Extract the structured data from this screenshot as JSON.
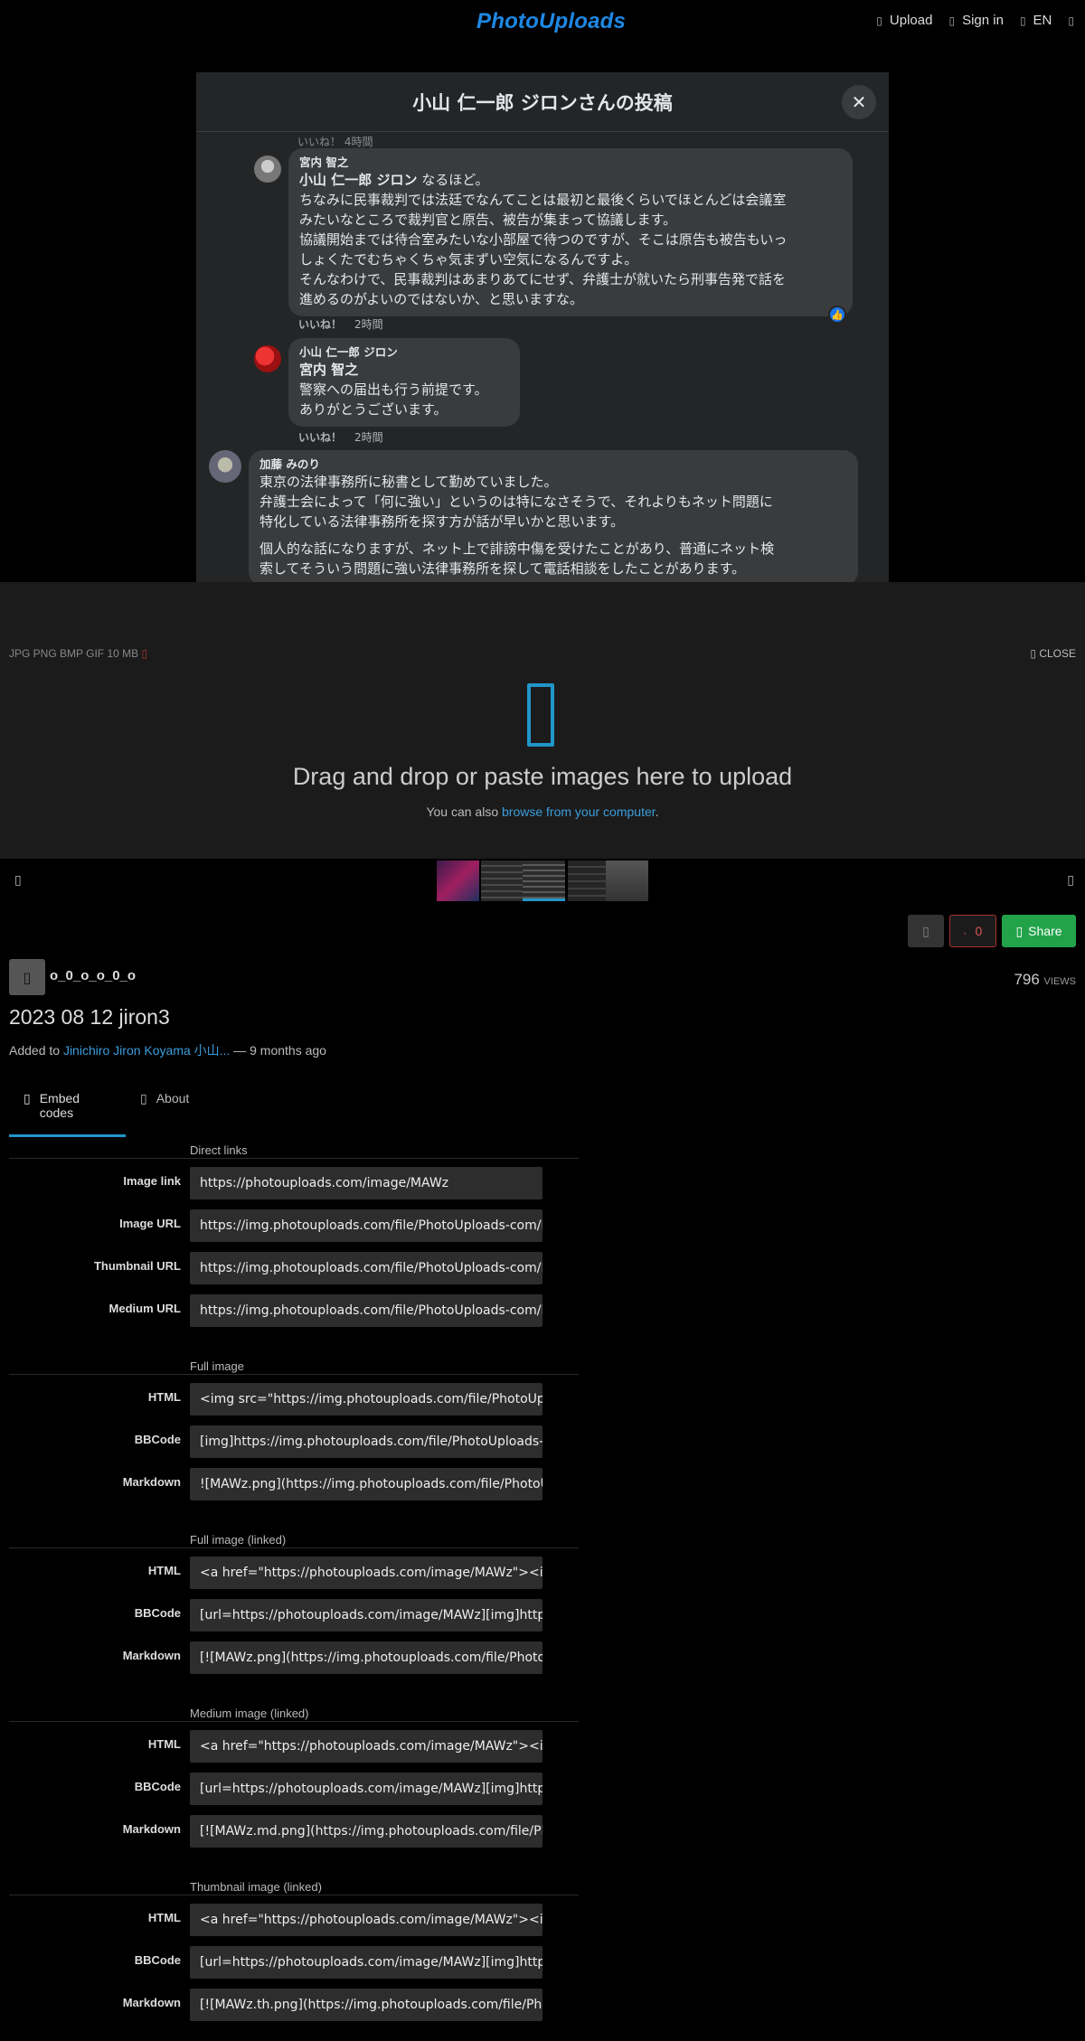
{
  "top": {
    "logo": "PhotoUploads",
    "upload": "Upload",
    "signin": "Sign in",
    "lang": "EN"
  },
  "shot": {
    "title": "小山 仁一郎 ジロンさんの投稿",
    "faded": "いいね！    4時間",
    "c1": {
      "author": "宮内 智之",
      "mention": "小山 仁一郎 ジロン",
      "line1_rest": " なるほど。",
      "lines": [
        "ちなみに民事裁判では法廷でなんてことは最初と最後くらいでほとんどは会議室",
        "みたいなところで裁判官と原告、被告が集まって協議します。",
        "協議開始までは待合室みたいな小部屋で待つのですが、そこは原告も被告もいっ",
        "しょくたでむちゃくちゃ気まずい空気になるんですよ。",
        "そんなわけで、民事裁判はあまりあてにせず、弁護士が就いたら刑事告発で話を",
        "進めるのがよいのではないか、と思いますな。"
      ],
      "like": "いいね！",
      "time": "2時間"
    },
    "c2": {
      "author": "小山 仁一郎 ジロン",
      "mention": "宮内 智之",
      "lines": [
        "警察への届出も行う前提です。",
        "ありがとうございます。"
      ],
      "like": "いいね！",
      "time": "2時間"
    },
    "c3": {
      "author": "加藤 みのり",
      "lines": [
        "東京の法律事務所に秘書として勤めていました。",
        "弁護士会によって「何に強い」というのは特になさそうで、それよりもネット問題に",
        "特化している法律事務所を探す方が話が早いかと思います。"
      ],
      "lines2": [
        "個人的な話になりますが、ネット上で誹謗中傷を受けたことがあり、普通にネット検",
        "索してそういう問題に強い法律事務所を探して電話相談をしたことがあります。"
      ]
    }
  },
  "uploader": {
    "formats": "JPG PNG BMP GIF   10 MB",
    "close": "CLOSE",
    "title": "Drag and drop or paste images here to upload",
    "sub_prefix": "You can also ",
    "sub_link": "browse from your computer",
    "sub_suffix": "."
  },
  "meta": {
    "likes": "0",
    "share": "Share",
    "owner": "o_0_o_o_0_o",
    "views_count": "796",
    "views_label": "VIEWS",
    "title": "2023 08 12 jiron3",
    "added_prefix": "Added to ",
    "album": "Jinichiro Jiron Koyama 小山...",
    "added_suffix": " — 9 months ago"
  },
  "tabs": {
    "embed": "Embed codes",
    "about": "About"
  },
  "embed": {
    "direct": {
      "title": "Direct links",
      "rows": [
        {
          "label": "Image link",
          "value": "https://photouploads.com/image/MAWz"
        },
        {
          "label": "Image URL",
          "value": "https://img.photouploads.com/file/PhotoUploads-com/MAWz.png"
        },
        {
          "label": "Thumbnail URL",
          "value": "https://img.photouploads.com/file/PhotoUploads-com/MAWz.th.png"
        },
        {
          "label": "Medium URL",
          "value": "https://img.photouploads.com/file/PhotoUploads-com/MAWz.md.png"
        }
      ]
    },
    "full": {
      "title": "Full image",
      "rows": [
        {
          "label": "HTML",
          "value": "<img src=\"https://img.photouploads.com/file/PhotoUploads-com/MAWz.png\">"
        },
        {
          "label": "BBCode",
          "value": "[img]https://img.photouploads.com/file/PhotoUploads-com/MAWz.png[/img]"
        },
        {
          "label": "Markdown",
          "value": "![MAWz.png](https://img.photouploads.com/file/PhotoUploads-com/MAWz.png)"
        }
      ]
    },
    "full_linked": {
      "title": "Full image (linked)",
      "rows": [
        {
          "label": "HTML",
          "value": "<a href=\"https://photouploads.com/image/MAWz\"><img src=\"https://img.photouploads.com\">"
        },
        {
          "label": "BBCode",
          "value": "[url=https://photouploads.com/image/MAWz][img]https://img.photouploads.com[/img][/url]"
        },
        {
          "label": "Markdown",
          "value": "[![MAWz.png](https://img.photouploads.com/file/PhotoUploads-com/MAWz.png)]"
        }
      ]
    },
    "medium_linked": {
      "title": "Medium image (linked)",
      "rows": [
        {
          "label": "HTML",
          "value": "<a href=\"https://photouploads.com/image/MAWz\"><img src=\"https://img.photouploads.com\">"
        },
        {
          "label": "BBCode",
          "value": "[url=https://photouploads.com/image/MAWz][img]https://img.photouploads.com[/img][/url]"
        },
        {
          "label": "Markdown",
          "value": "[![MAWz.md.png](https://img.photouploads.com/file/PhotoUploads-com/MAWz.md.png)]"
        }
      ]
    },
    "thumb_linked": {
      "title": "Thumbnail image (linked)",
      "rows": [
        {
          "label": "HTML",
          "value": "<a href=\"https://photouploads.com/image/MAWz\"><img src=\"https://img.photouploads.com\">"
        },
        {
          "label": "BBCode",
          "value": "[url=https://photouploads.com/image/MAWz][img]https://img.photouploads.com[/img][/url]"
        },
        {
          "label": "Markdown",
          "value": "[![MAWz.th.png](https://img.photouploads.com/file/PhotoUploads-com/MAWz.th.png)]"
        }
      ]
    }
  },
  "colors": {
    "accent": "#2196c9",
    "logo": "#1e88e5",
    "share": "#22a34a"
  }
}
